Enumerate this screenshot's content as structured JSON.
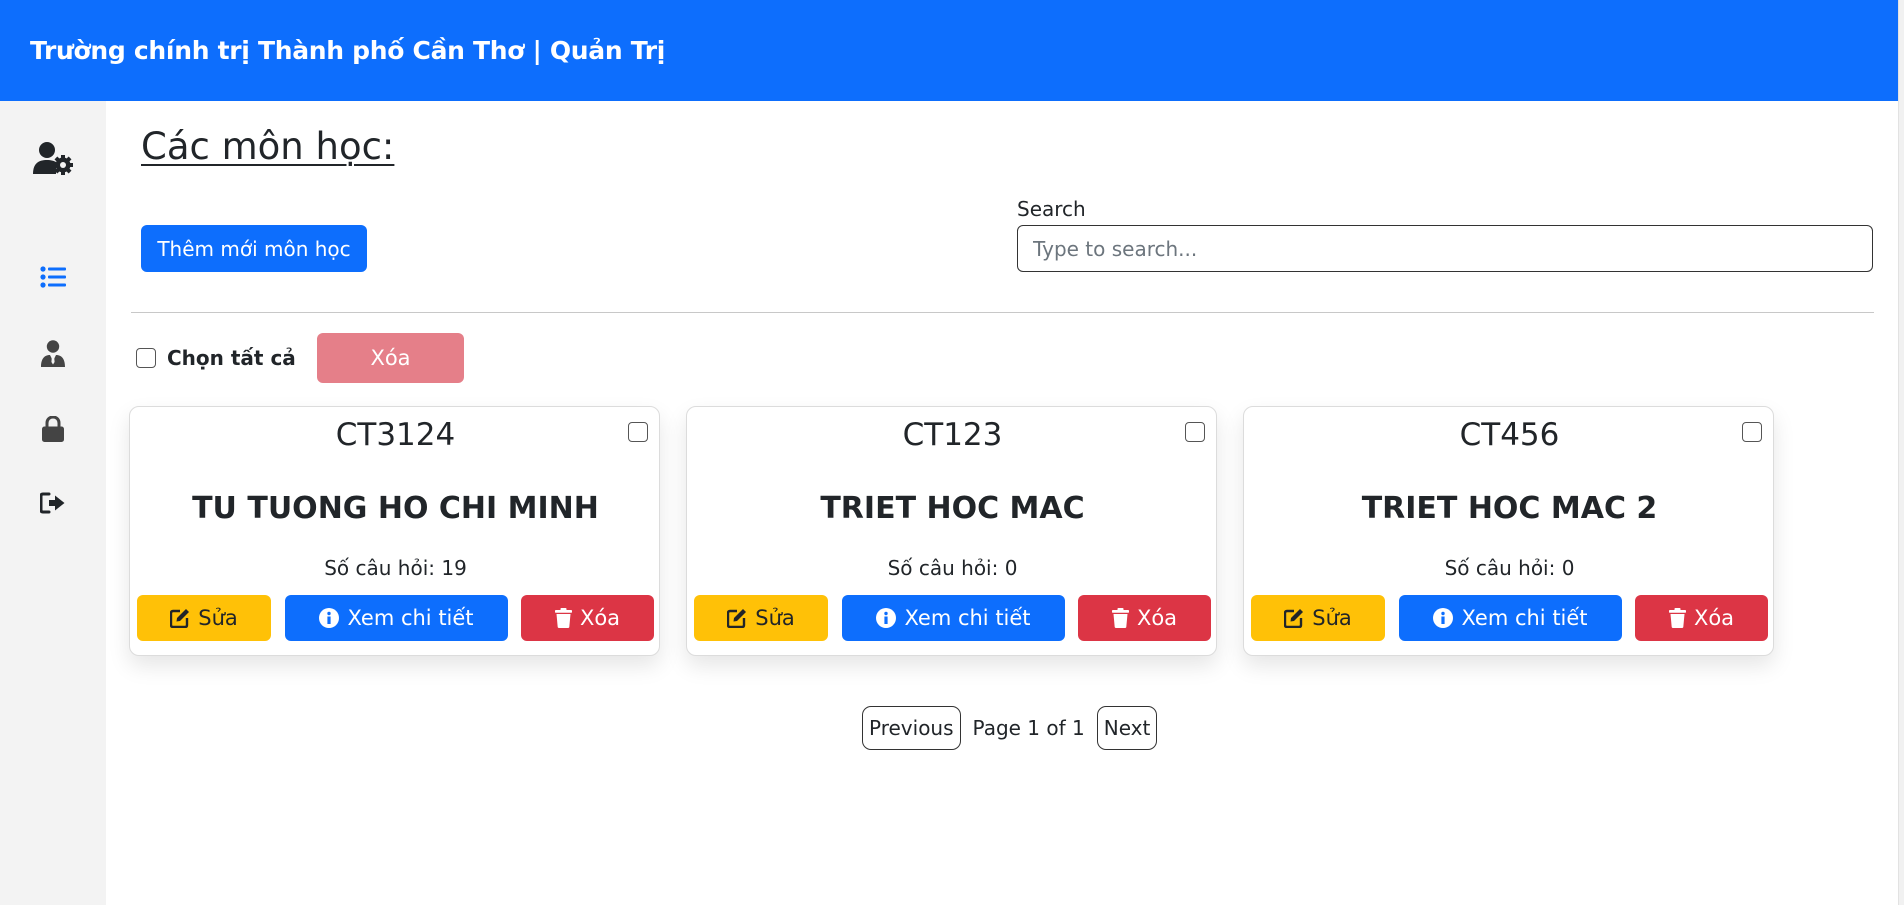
{
  "header": {
    "title": "Trường chính trị Thành phố Cần Thơ | Quản Trị"
  },
  "sidebar": {
    "items": [
      {
        "icon": "user-gear-icon"
      },
      {
        "icon": "list-icon",
        "active": true
      },
      {
        "icon": "user-tie-icon"
      },
      {
        "icon": "lock-icon"
      },
      {
        "icon": "sign-out-icon"
      }
    ]
  },
  "main": {
    "title": "Các môn học:",
    "add_button": "Thêm mới môn học",
    "search": {
      "label": "Search",
      "placeholder": "Type to search...",
      "value": ""
    },
    "select_all_label": "Chọn tất cả",
    "delete_selected": "Xóa"
  },
  "subjects": [
    {
      "code": "CT3124",
      "name": "TU TUONG HO CHI MINH",
      "question_count": "Số câu hỏi: 19",
      "edit": "Sửa",
      "view": "Xem chi tiết",
      "delete": "Xóa"
    },
    {
      "code": "CT123",
      "name": "TRIET HOC MAC",
      "question_count": "Số câu hỏi: 0",
      "edit": "Sửa",
      "view": "Xem chi tiết",
      "delete": "Xóa"
    },
    {
      "code": "CT456",
      "name": "TRIET HOC MAC 2",
      "question_count": "Số câu hỏi: 0",
      "edit": "Sửa",
      "view": "Xem chi tiết",
      "delete": "Xóa"
    }
  ],
  "pagination": {
    "previous": "Previous",
    "info": "Page 1 of 1",
    "next": "Next"
  },
  "colors": {
    "primary": "#0d6efd",
    "warning": "#ffc107",
    "danger": "#dc3545",
    "danger_disabled": "#e57f89",
    "sidebar_bg": "#f3f3f3"
  }
}
